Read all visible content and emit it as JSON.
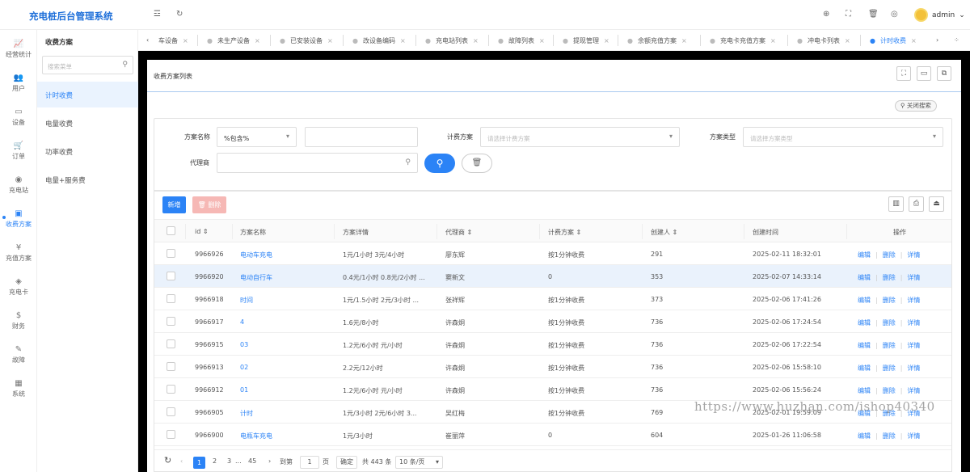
{
  "app": {
    "title": "充电桩后台管理系统",
    "user": "admin"
  },
  "topbar": {
    "menu_icon": "☲",
    "refresh_icon": "↻",
    "icons": [
      "globe-icon",
      "fullscreen-icon",
      "trash-icon",
      "theme-icon"
    ]
  },
  "leftnav": [
    {
      "label": "经营统计",
      "icon": "chart-icon"
    },
    {
      "label": "用户",
      "icon": "users-icon"
    },
    {
      "label": "设备",
      "icon": "device-icon"
    },
    {
      "label": "订单",
      "icon": "cart-icon"
    },
    {
      "label": "充电站",
      "icon": "location-icon"
    },
    {
      "label": "收费方案",
      "icon": "billing-icon",
      "active": true
    },
    {
      "label": "充值方案",
      "icon": "yen-icon"
    },
    {
      "label": "充电卡",
      "icon": "tag-icon"
    },
    {
      "label": "财务",
      "icon": "dollar-icon"
    },
    {
      "label": "故障",
      "icon": "wrench-icon"
    },
    {
      "label": "系统",
      "icon": "apps-icon"
    }
  ],
  "submenu": {
    "title": "收费方案",
    "search_placeholder": "搜索菜单",
    "items": [
      "计时收费",
      "电量收费",
      "功率收费",
      "电量+服务费"
    ],
    "active": "计时收费"
  },
  "tabs": [
    "车设备",
    "未生产设备",
    "已安装设备",
    "改设备编码",
    "充电站列表",
    "故障列表",
    "提现管理",
    "余额充值方案",
    "充电卡充值方案",
    "冲电卡列表",
    "计时收费"
  ],
  "active_tab": "计时收费",
  "panel": {
    "title": "收费方案列表",
    "close_search": "关闭搜索"
  },
  "search": {
    "name_label": "方案名称",
    "name_mode": "%包含%",
    "name_value": "",
    "billing_label": "计费方案",
    "billing_placeholder": "请选择计费方案",
    "type_label": "方案类型",
    "type_placeholder": "请选择方案类型",
    "agent_label": "代理商",
    "agent_value": ""
  },
  "toolbar": {
    "add": "新增",
    "delete": "删除"
  },
  "table": {
    "columns": [
      "id",
      "方案名称",
      "方案详情",
      "代理商",
      "计费方案",
      "创建人",
      "创建时间",
      "操作"
    ],
    "ops": [
      "编辑",
      "删除",
      "详情"
    ],
    "rows": [
      {
        "id": "9966926",
        "name": "电动车充电",
        "detail": "1元/1小时   3元/4小时",
        "agent": "廖东辉",
        "billing": "按1分钟收费",
        "creator": "291",
        "time": "2025-02-11 18:32:01"
      },
      {
        "id": "9966920",
        "name": "电动自行车",
        "detail": "0.4元/1小时   0.8元/2小时  ...",
        "agent": "窦新文",
        "billing": "0",
        "creator": "353",
        "time": "2025-02-07 14:33:14",
        "highlight": true
      },
      {
        "id": "9966918",
        "name": "时间",
        "detail": "1元/1.5小时   2元/3小时   ...",
        "agent": "张祥辉",
        "billing": "按1分钟收费",
        "creator": "373",
        "time": "2025-02-06 17:41:26"
      },
      {
        "id": "9966917",
        "name": "4",
        "detail": "1.6元/8小时",
        "agent": "许森炯",
        "billing": "按1分钟收费",
        "creator": "736",
        "time": "2025-02-06 17:24:54"
      },
      {
        "id": "9966915",
        "name": "03",
        "detail": "1.2元/6小时   元/小时",
        "agent": "许森炯",
        "billing": "按1分钟收费",
        "creator": "736",
        "time": "2025-02-06 17:22:54"
      },
      {
        "id": "9966913",
        "name": "02",
        "detail": "2.2元/12小时",
        "agent": "许森炯",
        "billing": "按1分钟收费",
        "creator": "736",
        "time": "2025-02-06 15:58:10"
      },
      {
        "id": "9966912",
        "name": "01",
        "detail": "1.2元/6小时   元/小时",
        "agent": "许森炯",
        "billing": "按1分钟收费",
        "creator": "736",
        "time": "2025-02-06 15:56:24"
      },
      {
        "id": "9966905",
        "name": "计时",
        "detail": "1元/3小时   2元/6小时   3...",
        "agent": "吴红梅",
        "billing": "按1分钟收费",
        "creator": "769",
        "time": "2025-02-01 19:59:09"
      },
      {
        "id": "9966900",
        "name": "电瓶车充电",
        "detail": "1元/3小时",
        "agent": "崔丽萍",
        "billing": "0",
        "creator": "604",
        "time": "2025-01-26 11:06:58"
      }
    ]
  },
  "pager": {
    "pages": [
      "1",
      "2",
      "3",
      "...",
      "45"
    ],
    "goto_label": "到第",
    "goto_value": "1",
    "page_unit": "页",
    "confirm": "确定",
    "total": "共 443 条",
    "page_size": "10 条/页"
  },
  "watermark": "https://www.huzhan.com/ishop40340"
}
